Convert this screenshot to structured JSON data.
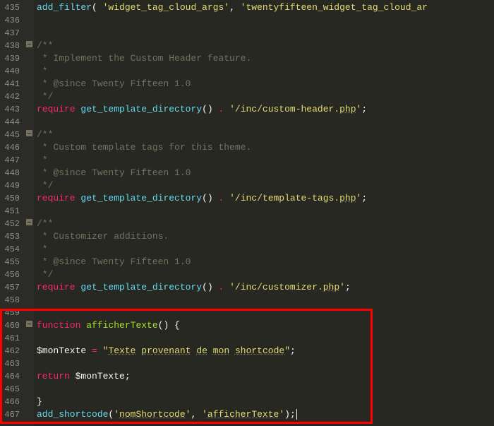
{
  "gutter": {
    "start": 435,
    "end": 467
  },
  "fold_lines": [
    438,
    445,
    452,
    460
  ],
  "colors": {
    "background": "#272822",
    "gutter_bg": "#2b2c27",
    "gutter_fg": "#8f908a",
    "highlight_border": "#ff0000",
    "keyword": "#f92672",
    "function": "#66d9ef",
    "definition": "#a6e22e",
    "string": "#e6db74",
    "comment": "#75715e",
    "variable": "#fd971f"
  },
  "code_lines": {
    "435": [
      {
        "t": "add_filter",
        "c": "tok-fn"
      },
      {
        "t": "( ",
        "c": "tok-pn"
      },
      {
        "t": "'widget_tag_cloud_args'",
        "c": "tok-str"
      },
      {
        "t": ", ",
        "c": "tok-pn"
      },
      {
        "t": "'twentyfifteen_widget_tag_cloud_ar",
        "c": "tok-str"
      }
    ],
    "436": [],
    "437": [],
    "438": [
      {
        "t": "/**",
        "c": "tok-cm"
      }
    ],
    "439": [
      {
        "t": " * Implement the Custom Header feature.",
        "c": "tok-cm"
      }
    ],
    "440": [
      {
        "t": " *",
        "c": "tok-cm"
      }
    ],
    "441": [
      {
        "t": " * @since Twenty Fifteen 1.0",
        "c": "tok-cm"
      }
    ],
    "442": [
      {
        "t": " */",
        "c": "tok-cm"
      }
    ],
    "443": [
      {
        "t": "require",
        "c": "tok-kw"
      },
      {
        "t": " ",
        "c": "tok-pn"
      },
      {
        "t": "get_template_directory",
        "c": "tok-fn"
      },
      {
        "t": "() ",
        "c": "tok-pn"
      },
      {
        "t": ".",
        "c": "tok-op"
      },
      {
        "t": " ",
        "c": "tok-pn"
      },
      {
        "t": "'/inc/custom-header.",
        "c": "tok-str"
      },
      {
        "t": "php",
        "c": "tok-str und"
      },
      {
        "t": "'",
        "c": "tok-str"
      },
      {
        "t": ";",
        "c": "tok-pn"
      }
    ],
    "444": [],
    "445": [
      {
        "t": "/**",
        "c": "tok-cm"
      }
    ],
    "446": [
      {
        "t": " * Custom template tags for this theme.",
        "c": "tok-cm"
      }
    ],
    "447": [
      {
        "t": " *",
        "c": "tok-cm"
      }
    ],
    "448": [
      {
        "t": " * @since Twenty Fifteen 1.0",
        "c": "tok-cm"
      }
    ],
    "449": [
      {
        "t": " */",
        "c": "tok-cm"
      }
    ],
    "450": [
      {
        "t": "require",
        "c": "tok-kw"
      },
      {
        "t": " ",
        "c": "tok-pn"
      },
      {
        "t": "get_template_directory",
        "c": "tok-fn"
      },
      {
        "t": "() ",
        "c": "tok-pn"
      },
      {
        "t": ".",
        "c": "tok-op"
      },
      {
        "t": " ",
        "c": "tok-pn"
      },
      {
        "t": "'/inc/template-tags.",
        "c": "tok-str"
      },
      {
        "t": "php",
        "c": "tok-str und"
      },
      {
        "t": "'",
        "c": "tok-str"
      },
      {
        "t": ";",
        "c": "tok-pn"
      }
    ],
    "451": [],
    "452": [
      {
        "t": "/**",
        "c": "tok-cm"
      }
    ],
    "453": [
      {
        "t": " * Customizer additions.",
        "c": "tok-cm"
      }
    ],
    "454": [
      {
        "t": " *",
        "c": "tok-cm"
      }
    ],
    "455": [
      {
        "t": " * @since Twenty Fifteen 1.0",
        "c": "tok-cm"
      }
    ],
    "456": [
      {
        "t": " */",
        "c": "tok-cm"
      }
    ],
    "457": [
      {
        "t": "require",
        "c": "tok-kw"
      },
      {
        "t": " ",
        "c": "tok-pn"
      },
      {
        "t": "get_template_directory",
        "c": "tok-fn"
      },
      {
        "t": "() ",
        "c": "tok-pn"
      },
      {
        "t": ".",
        "c": "tok-op"
      },
      {
        "t": " ",
        "c": "tok-pn"
      },
      {
        "t": "'/inc/customizer.",
        "c": "tok-str"
      },
      {
        "t": "php",
        "c": "tok-str und"
      },
      {
        "t": "'",
        "c": "tok-str"
      },
      {
        "t": ";",
        "c": "tok-pn"
      }
    ],
    "458": [],
    "459": [],
    "460": [
      {
        "t": "function",
        "c": "tok-kw"
      },
      {
        "t": " ",
        "c": "tok-pn"
      },
      {
        "t": "afficherTexte",
        "c": "tok-def"
      },
      {
        "t": "() {",
        "c": "tok-pn"
      }
    ],
    "461": [],
    "462": [
      {
        "t": "$monTexte",
        "c": "tok-var"
      },
      {
        "t": " ",
        "c": "tok-pn"
      },
      {
        "t": "=",
        "c": "tok-op"
      },
      {
        "t": " ",
        "c": "tok-pn"
      },
      {
        "t": "\"",
        "c": "tok-str"
      },
      {
        "t": "Texte",
        "c": "tok-str und"
      },
      {
        "t": " ",
        "c": "tok-str"
      },
      {
        "t": "provenant",
        "c": "tok-str und"
      },
      {
        "t": " ",
        "c": "tok-str"
      },
      {
        "t": "de",
        "c": "tok-str und"
      },
      {
        "t": " ",
        "c": "tok-str"
      },
      {
        "t": "mon",
        "c": "tok-str und"
      },
      {
        "t": " ",
        "c": "tok-str"
      },
      {
        "t": "shortcode",
        "c": "tok-str und"
      },
      {
        "t": "\"",
        "c": "tok-str"
      },
      {
        "t": ";",
        "c": "tok-pn"
      }
    ],
    "463": [],
    "464": [
      {
        "t": "return",
        "c": "tok-kw"
      },
      {
        "t": " $monTexte;",
        "c": "tok-pn"
      }
    ],
    "465": [],
    "466": [
      {
        "t": "}",
        "c": "tok-pn"
      }
    ],
    "467": [
      {
        "t": "add_shortcode",
        "c": "tok-fn"
      },
      {
        "t": "(",
        "c": "tok-pn"
      },
      {
        "t": "'",
        "c": "tok-str"
      },
      {
        "t": "nomShortcode",
        "c": "tok-str und"
      },
      {
        "t": "'",
        "c": "tok-str"
      },
      {
        "t": ", ",
        "c": "tok-pn"
      },
      {
        "t": "'",
        "c": "tok-str"
      },
      {
        "t": "afficherTexte",
        "c": "tok-str und"
      },
      {
        "t": "'",
        "c": "tok-str"
      },
      {
        "t": ");",
        "c": "tok-pn"
      }
    ]
  }
}
